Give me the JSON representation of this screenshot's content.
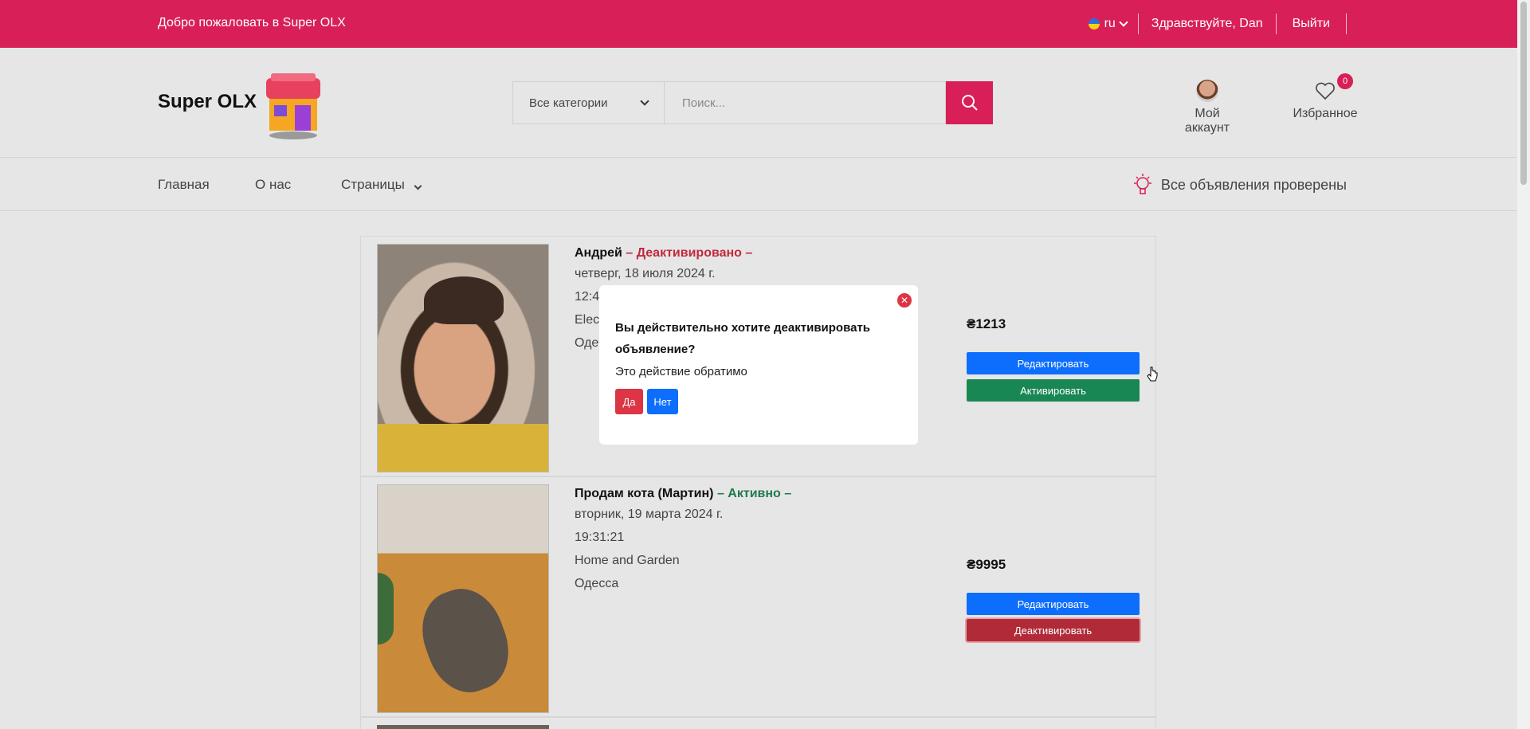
{
  "topbar": {
    "welcome": "Добро пожаловать в Super OLX",
    "lang": "ru",
    "hello": "Здравствуйте, Dan",
    "logout": "Выйти"
  },
  "header": {
    "logo": "Super OLX",
    "category": "Все категории",
    "search_placeholder": "Поиск...",
    "account": "Мой аккаунт",
    "favorites": "Избранное",
    "favorites_count": "0"
  },
  "nav": {
    "home": "Главная",
    "about": "О нас",
    "pages": "Страницы",
    "verified": "Все объявления проверены"
  },
  "listings": [
    {
      "title": "Андрей",
      "status": "– Деактивировано –",
      "date": "четверг, 18 июля 2024 г.",
      "time": "12:4",
      "category": "Elect",
      "city": "Оде",
      "price": "₴1213",
      "edit": "Редактировать",
      "toggle": "Активировать"
    },
    {
      "title": "Продам кота (Мартин)",
      "status": "– Активно –",
      "date": "вторник, 19 марта 2024 г.",
      "time": "19:31:21",
      "category": "Home and Garden",
      "city": "Одесса",
      "price": "₴9995",
      "edit": "Редактировать",
      "toggle": "Деактивировать"
    }
  ],
  "modal": {
    "question": "Вы действительно хотите деактивировать объявление?",
    "note": "Это действие обратимо",
    "yes": "Да",
    "no": "Нет"
  },
  "colors": {
    "brand": "#d81f57",
    "primary": "#0d6efd",
    "success": "#198754",
    "danger": "#b02a37"
  }
}
